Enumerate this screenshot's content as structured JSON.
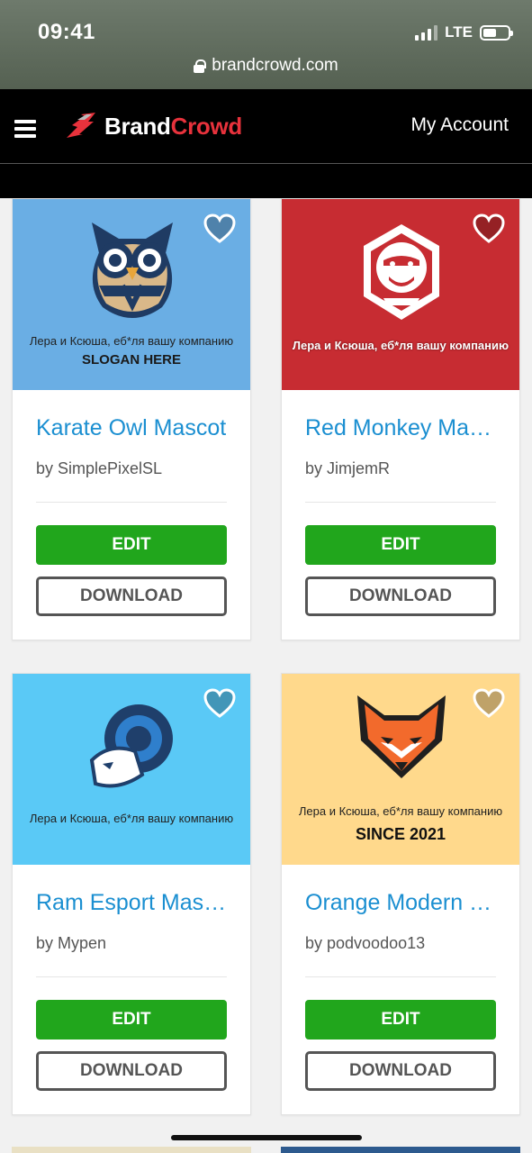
{
  "status_bar": {
    "time": "09:41",
    "network": "LTE"
  },
  "browser": {
    "url": "brandcrowd.com"
  },
  "header": {
    "logo_part1": "Brand",
    "logo_part2": "Crowd",
    "account_link": "My Account"
  },
  "cards": [
    {
      "title": "Karate Owl Mascot",
      "author": "by SimplePixelSL",
      "tagline": "Лера и Ксюша, еб*ля вашу компанию",
      "slogan": "SLOGAN HERE",
      "edit_label": "EDIT",
      "download_label": "DOWNLOAD",
      "bg_color": "#6aaee4"
    },
    {
      "title": "Red Monkey Mas…",
      "author": "by JimjemR",
      "tagline": "Лера и Ксюша, еб*ля вашу компанию",
      "slogan": "",
      "edit_label": "EDIT",
      "download_label": "DOWNLOAD",
      "bg_color": "#c72c32"
    },
    {
      "title": "Ram Esport Masc…",
      "author": "by Mypen",
      "tagline": "Лера и Ксюша, еб*ля вашу компанию",
      "slogan": "",
      "edit_label": "EDIT",
      "download_label": "DOWNLOAD",
      "bg_color": "#5ac9f6"
    },
    {
      "title": "Orange Modern …",
      "author": "by podvoodoo13",
      "tagline": "Лера и Ксюша, еб*ля вашу компанию",
      "slogan": "SINCE 2021",
      "edit_label": "EDIT",
      "download_label": "DOWNLOAD",
      "bg_color": "#ffd98c"
    }
  ],
  "colors": {
    "accent_blue": "#1b8fd1",
    "edit_green": "#21a61c",
    "brand_red": "#e8323c"
  }
}
